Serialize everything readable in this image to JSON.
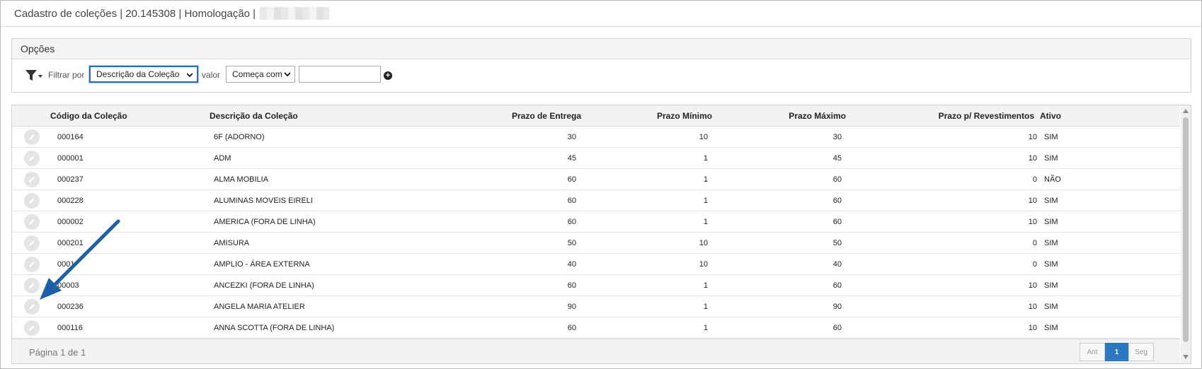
{
  "window": {
    "title": "Cadastro de coleções | 20.145308 | Homologação |"
  },
  "options": {
    "heading": "Opções",
    "filter_icon": "filter-dropdown-icon",
    "filter_label": "Filtrar por",
    "filter_field_selected": "Descrição da Coleção",
    "value_label": "valor",
    "operator_selected": "Começa com",
    "value_input": "",
    "add_icon": "plus-circle-icon"
  },
  "table": {
    "columns": {
      "codigo": "Código da Coleção",
      "descricao": "Descrição da Coleção",
      "prazo_entrega": "Prazo de Entrega",
      "prazo_minimo": "Prazo Mínimo",
      "prazo_maximo": "Prazo Máximo",
      "prazo_revestimentos": "Prazo p/ Revestimentos",
      "ativo": "Ativo"
    },
    "rows": [
      {
        "codigo": "000164",
        "descricao": "6F (ADORNO)",
        "prazo_entrega": "30",
        "prazo_minimo": "10",
        "prazo_maximo": "30",
        "prazo_revestimentos": "10",
        "ativo": "SIM"
      },
      {
        "codigo": "000001",
        "descricao": "ADM",
        "prazo_entrega": "45",
        "prazo_minimo": "1",
        "prazo_maximo": "45",
        "prazo_revestimentos": "10",
        "ativo": "SIM"
      },
      {
        "codigo": "000237",
        "descricao": "ALMA MOBILIA",
        "prazo_entrega": "60",
        "prazo_minimo": "1",
        "prazo_maximo": "60",
        "prazo_revestimentos": "0",
        "ativo": "NÃO"
      },
      {
        "codigo": "000228",
        "descricao": "ALUMINAS MOVEIS EIRELI",
        "prazo_entrega": "60",
        "prazo_minimo": "1",
        "prazo_maximo": "60",
        "prazo_revestimentos": "10",
        "ativo": "SIM"
      },
      {
        "codigo": "000002",
        "descricao": "AMERICA (FORA DE LINHA)",
        "prazo_entrega": "60",
        "prazo_minimo": "1",
        "prazo_maximo": "60",
        "prazo_revestimentos": "10",
        "ativo": "SIM"
      },
      {
        "codigo": "000201",
        "descricao": "AMISURA",
        "prazo_entrega": "50",
        "prazo_minimo": "10",
        "prazo_maximo": "50",
        "prazo_revestimentos": "0",
        "ativo": "SIM"
      },
      {
        "codigo": "0001",
        "descricao": "AMPLIO - ÁREA EXTERNA",
        "prazo_entrega": "40",
        "prazo_minimo": "10",
        "prazo_maximo": "40",
        "prazo_revestimentos": "0",
        "ativo": "SIM"
      },
      {
        "codigo": "00003",
        "descricao": "ANCEZKI (FORA DE LINHA)",
        "prazo_entrega": "60",
        "prazo_minimo": "1",
        "prazo_maximo": "60",
        "prazo_revestimentos": "10",
        "ativo": "SIM"
      },
      {
        "codigo": "000236",
        "descricao": "ANGELA MARIA ATELIER",
        "prazo_entrega": "90",
        "prazo_minimo": "1",
        "prazo_maximo": "90",
        "prazo_revestimentos": "10",
        "ativo": "SIM"
      },
      {
        "codigo": "000116",
        "descricao": "ANNA SCOTTA (FORA DE LINHA)",
        "prazo_entrega": "60",
        "prazo_minimo": "1",
        "prazo_maximo": "60",
        "prazo_revestimentos": "10",
        "ativo": "SIM"
      }
    ],
    "edit_icon": "pencil-icon"
  },
  "footer": {
    "page_info": "Página 1 de 1",
    "prev_label": "Ant",
    "current_page": "1",
    "next_label": "Seg"
  },
  "colors": {
    "accent": "#2c78c0",
    "annotation_arrow": "#1f5fa8"
  }
}
